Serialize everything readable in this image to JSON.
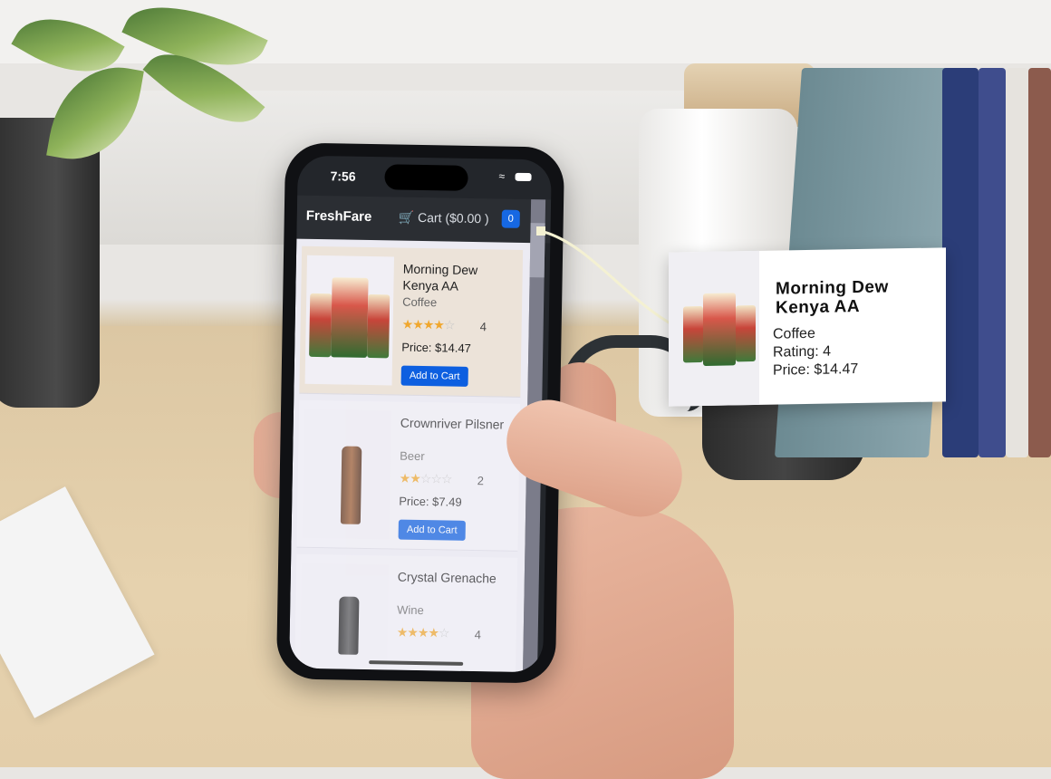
{
  "status_bar": {
    "time": "7:56",
    "wifi_icon": "wifi-icon",
    "battery_icon": "battery-icon"
  },
  "app": {
    "brand": "FreshFare",
    "cart_label": "🛒 Cart ($0.00 )",
    "cart_count": "0",
    "accent_color": "#0d5fe0"
  },
  "products": [
    {
      "name": "Morning Dew Kenya AA",
      "category": "Coffee",
      "rating": 4,
      "rating_text": "4",
      "price": "Price: $14.47",
      "button": "Add to Cart"
    },
    {
      "name": "Crownriver Pilsner",
      "category": "Beer",
      "rating": 2,
      "rating_text": "2",
      "price": "Price: $7.49",
      "button": "Add to Cart"
    },
    {
      "name": "Crystal Grenache",
      "category": "Wine",
      "rating": 4,
      "rating_text": "4"
    }
  ],
  "popup": {
    "title": "Morning Dew Kenya AA",
    "category": "Coffee",
    "rating": "Rating: 4",
    "price": "Price: $14.47"
  }
}
